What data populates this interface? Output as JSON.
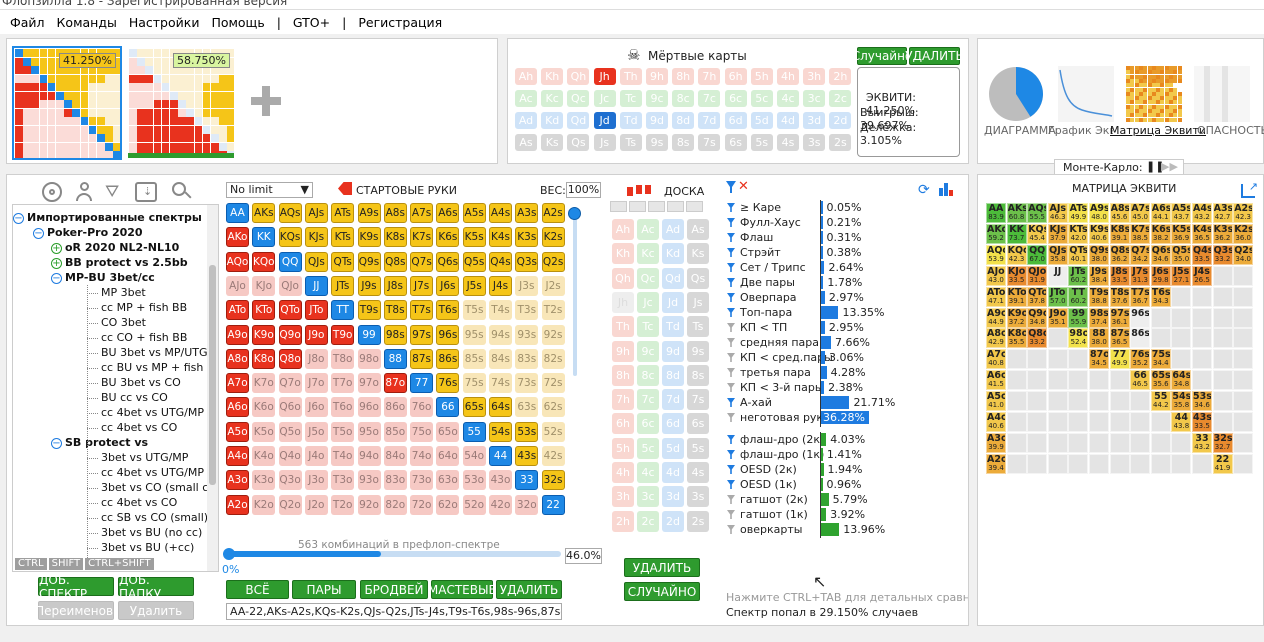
{
  "window_title": "Флопзилла 1.8 - Зарегистрированная версия",
  "menu": [
    "Файл",
    "Команды",
    "Настройки",
    "Помощь",
    "|",
    "GTO+",
    "|",
    "Регистрация"
  ],
  "ranges": [
    {
      "pct": "41.250%"
    },
    {
      "pct": "58.750%"
    }
  ],
  "dead_cards": {
    "title": "Мёртвые карты",
    "random_label": "Случайно",
    "delete_label": "УДАЛИТЬ",
    "rows": [
      {
        "suit": "h",
        "cards": [
          "Ah",
          "Kh",
          "Qh",
          "Jh",
          "Th",
          "9h",
          "8h",
          "7h",
          "6h",
          "5h",
          "4h",
          "3h",
          "2h"
        ]
      },
      {
        "suit": "c",
        "cards": [
          "Ac",
          "Kc",
          "Qc",
          "Jc",
          "Tc",
          "9c",
          "8c",
          "7c",
          "6c",
          "5c",
          "4c",
          "3c",
          "2c"
        ]
      },
      {
        "suit": "d",
        "cards": [
          "Ad",
          "Kd",
          "Qd",
          "Jd",
          "Td",
          "9d",
          "8d",
          "7d",
          "6d",
          "5d",
          "4d",
          "3d",
          "2d"
        ]
      },
      {
        "suit": "s",
        "cards": [
          "As",
          "Ks",
          "Qs",
          "Js",
          "Ts",
          "9s",
          "8s",
          "7s",
          "6s",
          "5s",
          "4s",
          "3s",
          "2s"
        ]
      }
    ],
    "dead": [
      "Jh",
      "Jd"
    ],
    "equity": "ЭКВИТИ: 41.250%",
    "win": "Выигрыш: 39.697%",
    "tie": "Делёжка: 3.105%"
  },
  "views": {
    "tabs": [
      "ДИАГРАММА",
      "График Экв",
      "Матрица Эквити",
      "ОПАСНОСТЬ"
    ],
    "active": "Матрица Эквити",
    "monte_carlo": "Монте-Карло:",
    "pie_fraction": 0.41
  },
  "tree": {
    "items": [
      {
        "label": "Импортированные спектры",
        "level": 1,
        "bold": true,
        "node": "minus"
      },
      {
        "label": "Poker-Pro 2020",
        "level": 2,
        "bold": true,
        "node": "minus"
      },
      {
        "label": "oR 2020 NL2-NL10",
        "level": 3,
        "bold": true,
        "node": "plus"
      },
      {
        "label": "BB protect vs 2.5bb",
        "level": 3,
        "bold": true,
        "node": "plus"
      },
      {
        "label": "MP-BU 3bet/cc",
        "level": 3,
        "bold": true,
        "node": "minus"
      },
      {
        "label": "MP 3bet",
        "level": 4
      },
      {
        "label": "cc MP + fish BB",
        "level": 4
      },
      {
        "label": "CO 3bet",
        "level": 4
      },
      {
        "label": "cc CO + fish BB",
        "level": 4
      },
      {
        "label": "BU 3bet vs MP/UTG",
        "level": 4
      },
      {
        "label": "cc BU vs MP + fish BB",
        "level": 4
      },
      {
        "label": "BU 3bet vs CO",
        "level": 4
      },
      {
        "label": "BU cc vs CO",
        "level": 4
      },
      {
        "label": "cc 4bet vs UTG/MP",
        "level": 4
      },
      {
        "label": "cc 4bet vs CO",
        "level": 4
      },
      {
        "label": "SB protect vs",
        "level": 3,
        "bold": true,
        "node": "minus"
      },
      {
        "label": "3bet vs UTG/MP",
        "level": 4
      },
      {
        "label": "cc 4bet vs UTG/MP",
        "level": 4
      },
      {
        "label": "3bet vs CO (small cc)",
        "level": 4
      },
      {
        "label": "cc 4bet vs CO",
        "level": 4
      },
      {
        "label": "cc SB vs CO (small)",
        "level": 4
      },
      {
        "label": "3bet vs BU (no cc)",
        "level": 4
      },
      {
        "label": "3bet vs BU (+cc)",
        "level": 4
      }
    ],
    "keys": [
      "CTRL",
      "SHIFT",
      "CTRL+SHIFT"
    ],
    "add_range": "ДОБ. СПЕКТР",
    "add_folder": "ДОБ. ПАПКУ",
    "rename": "Переименов.",
    "delete": "Удалить"
  },
  "hands": {
    "mode": "No limit",
    "title": "СТАРТОВЫЕ РУКИ",
    "weight_label": "ВЕС:",
    "weight": "100%",
    "combos": "563 комбинаций в префлоп-спектре",
    "slider_min": "0%",
    "slider_value": "46.0%",
    "slider_fraction": 0.46,
    "buttons": [
      "ВСЁ",
      "ПАРЫ",
      "БРОДВЕЙ",
      "МАСТЕВЫЕ",
      "УДАЛИТЬ"
    ],
    "range_text": "AA-22,AKs-A2s,KQs-K2s,QJs-Q2s,JTs-J4s,T9s-T6s,98s-96s,87s-86s",
    "ranks": [
      "A",
      "K",
      "Q",
      "J",
      "T",
      "9",
      "8",
      "7",
      "6",
      "5",
      "4",
      "3",
      "2"
    ],
    "selected_rows": [
      [
        "A",
        "K",
        "Q",
        "J",
        "T",
        "9",
        "8",
        "7",
        "6",
        "5",
        "4",
        "3",
        "2"
      ],
      [
        "A",
        "K",
        "Q",
        "J",
        "T",
        "9",
        "8",
        "7",
        "6",
        "5",
        "4",
        "3",
        "2"
      ],
      [
        "A",
        "K",
        "Q",
        "J",
        "T",
        "9",
        "8",
        "7",
        "6",
        "5",
        "4",
        "3",
        "2"
      ],
      [
        "J",
        "T",
        "9",
        "8",
        "7",
        "6",
        "5",
        "4"
      ],
      [
        "A",
        "K",
        "Q",
        "J",
        "T",
        "9",
        "8",
        "7",
        "6"
      ],
      [
        "A",
        "K",
        "Q",
        "J",
        "T",
        "9",
        "8",
        "7",
        "6"
      ],
      [
        "A",
        "K",
        "Q",
        "8",
        "7",
        "6"
      ],
      [
        "A",
        "8",
        "7",
        "6"
      ],
      [
        "A",
        "6",
        "5",
        "4"
      ],
      [
        "A",
        "5",
        "4",
        "3"
      ],
      [
        "A",
        "4",
        "3"
      ],
      [
        "A",
        "3",
        "2"
      ],
      [
        "A",
        "2"
      ]
    ]
  },
  "board": {
    "title": "ДОСКА",
    "ranks": [
      "A",
      "K",
      "Q",
      "J",
      "T",
      "9",
      "8",
      "7",
      "6",
      "5",
      "4",
      "3",
      "2"
    ],
    "suits": [
      "h",
      "c",
      "d",
      "s"
    ],
    "dead": [
      "Jh"
    ],
    "delete": "УДАЛИТЬ",
    "random": "СЛУЧАЙНО"
  },
  "stats": {
    "made": [
      {
        "label": "≥ Каре",
        "value": "0.05%",
        "pct": 0.05
      },
      {
        "label": "Фулл-Хаус",
        "value": "0.21%",
        "pct": 0.21
      },
      {
        "label": "Флаш",
        "value": "0.31%",
        "pct": 0.31
      },
      {
        "label": "Стрэйт",
        "value": "0.38%",
        "pct": 0.38
      },
      {
        "label": "Сет / Трипс",
        "value": "2.64%",
        "pct": 2.64
      },
      {
        "label": "Две пары",
        "value": "1.78%",
        "pct": 1.78
      },
      {
        "label": "Оверпара",
        "value": "2.97%",
        "pct": 2.97
      },
      {
        "label": "Топ-пара",
        "value": "13.35%",
        "pct": 13.35
      },
      {
        "label": "КП < ТП",
        "value": "2.95%",
        "pct": 2.95
      },
      {
        "label": "средняя пара",
        "value": "7.66%",
        "pct": 7.66
      },
      {
        "label": "КП < сред.пары",
        "value": "3.06%",
        "pct": 3.06
      },
      {
        "label": "третья пара",
        "value": "4.28%",
        "pct": 4.28
      },
      {
        "label": "КП < 3-й пары",
        "value": "2.38%",
        "pct": 2.38
      },
      {
        "label": "А-хай",
        "value": "21.71%",
        "pct": 21.71
      },
      {
        "label": "неготовая рука",
        "value": "36.28%",
        "pct": 36.28
      }
    ],
    "draws": [
      {
        "label": "флаш-дро (2к)",
        "value": "4.03%",
        "pct": 4.03
      },
      {
        "label": "флаш-дро (1к)",
        "value": "1.41%",
        "pct": 1.41
      },
      {
        "label": "OESD (2к)",
        "value": "1.94%",
        "pct": 1.94
      },
      {
        "label": "OESD (1к)",
        "value": "0.96%",
        "pct": 0.96
      },
      {
        "label": "гатшот (2к)",
        "value": "5.79%",
        "pct": 5.79
      },
      {
        "label": "гатшот (1к)",
        "value": "3.92%",
        "pct": 3.92
      },
      {
        "label": "оверкарты",
        "value": "13.96%",
        "pct": 13.96
      }
    ],
    "hint": "Нажмите CTRL+TAB для детальных сравнений",
    "hit": "Спектр попал в 29.150% случаев"
  },
  "equity_matrix": {
    "title": "МАТРИЦА ЭКВИТИ",
    "cells": [
      [
        [
          "AA",
          "83.9"
        ],
        [
          "AKs",
          "60.8"
        ],
        [
          "AQs",
          "55.5"
        ],
        [
          "AJs",
          "46.3"
        ],
        [
          "ATs",
          "49.9"
        ],
        [
          "A9s",
          "48.0"
        ],
        [
          "A8s",
          "45.6"
        ],
        [
          "A7s",
          "45.0"
        ],
        [
          "A6s",
          "44.1"
        ],
        [
          "A5s",
          "43.7"
        ],
        [
          "A4s",
          "43.2"
        ],
        [
          "A3s",
          "42.7"
        ],
        [
          "A2s",
          "42.3"
        ]
      ],
      [
        [
          "AKo",
          "59.2"
        ],
        [
          "KK",
          "73.7"
        ],
        [
          "KQs",
          "45.4"
        ],
        [
          "KJs",
          "37.9"
        ],
        [
          "KTs",
          "42.0"
        ],
        [
          "K9s",
          "40.6"
        ],
        [
          "K8s",
          "39.1"
        ],
        [
          "K7s",
          "38.5"
        ],
        [
          "K6s",
          "38.2"
        ],
        [
          "K5s",
          "36.9"
        ],
        [
          "K4s",
          "36.5"
        ],
        [
          "K3s",
          "36.2"
        ],
        [
          "K2s",
          "36.0"
        ]
      ],
      [
        [
          "AQo",
          "53.9"
        ],
        [
          "KQo",
          "42.3"
        ],
        [
          "QQ",
          "67.0"
        ],
        [
          "QJs",
          "35.8"
        ],
        [
          "QTs",
          "40.1"
        ],
        [
          "Q9s",
          "38.0"
        ],
        [
          "Q8s",
          "36.2"
        ],
        [
          "Q7s",
          "34.2"
        ],
        [
          "Q6s",
          "34.6"
        ],
        [
          "Q5s",
          "35.0"
        ],
        [
          "Q4s",
          "33.5"
        ],
        [
          "Q3s",
          "33.2"
        ],
        [
          "Q2s",
          "34.0"
        ]
      ],
      [
        [
          "AJo",
          "43.0"
        ],
        [
          "KJo",
          "33.5"
        ],
        [
          "QJo",
          "31.9"
        ],
        [
          "JJ",
          "",
          true
        ],
        [
          "JTs",
          "60.2"
        ],
        [
          "J9s",
          "38.4"
        ],
        [
          "J8s",
          "33.5"
        ],
        [
          "J7s",
          "31.3"
        ],
        [
          "J6s",
          "29.8"
        ],
        [
          "J5s",
          "27.1"
        ],
        [
          "J4s",
          "26.5"
        ],
        [
          "",
          ""
        ],
        [
          "",
          ""
        ]
      ],
      [
        [
          "ATo",
          "47.1"
        ],
        [
          "KTo",
          "39.1"
        ],
        [
          "QTo",
          "37.8"
        ],
        [
          "JTo",
          "57.0"
        ],
        [
          "TT",
          "60.2"
        ],
        [
          "T9s",
          "38.8"
        ],
        [
          "T8s",
          "37.6"
        ],
        [
          "T7s",
          "36.7"
        ],
        [
          "T6s",
          "34.3"
        ],
        [
          "",
          ""
        ],
        [
          "",
          ""
        ],
        [
          "",
          ""
        ],
        [
          "",
          ""
        ]
      ],
      [
        [
          "A9o",
          "44.9"
        ],
        [
          "K9o",
          "37.2"
        ],
        [
          "Q9o",
          "34.8"
        ],
        [
          "J9o",
          "35.1"
        ],
        [
          "99",
          "55.9"
        ],
        [
          "98s",
          "37.4"
        ],
        [
          "97s",
          "36.1"
        ],
        [
          "96s",
          "",
          false
        ],
        [
          "",
          ""
        ],
        [
          "",
          ""
        ],
        [
          "",
          ""
        ],
        [
          "",
          ""
        ],
        [
          "",
          ""
        ]
      ],
      [
        [
          "A8o",
          "42.9"
        ],
        [
          "K8o",
          "35.5"
        ],
        [
          "Q8o",
          "33.2"
        ],
        [
          "",
          ""
        ],
        [
          "98o",
          "52.4"
        ],
        [
          "88",
          "38.0"
        ],
        [
          "87s",
          "36.5"
        ],
        [
          "86s",
          "",
          false
        ],
        [
          "",
          ""
        ],
        [
          "",
          ""
        ],
        [
          "",
          ""
        ],
        [
          "",
          ""
        ],
        [
          "",
          ""
        ]
      ],
      [
        [
          "A7o",
          "40.8"
        ],
        [
          "",
          ""
        ],
        [
          "",
          ""
        ],
        [
          "",
          ""
        ],
        [
          "",
          ""
        ],
        [
          "87o",
          "34.5"
        ],
        [
          "77",
          "49.9"
        ],
        [
          "76s",
          "35.2"
        ],
        [
          "75s",
          "34.4"
        ],
        [
          "",
          ""
        ],
        [
          "",
          ""
        ],
        [
          "",
          ""
        ],
        [
          "",
          ""
        ]
      ],
      [
        [
          "A6o",
          "41.5"
        ],
        [
          "",
          ""
        ],
        [
          "",
          ""
        ],
        [
          "",
          ""
        ],
        [
          "",
          ""
        ],
        [
          "",
          ""
        ],
        [
          "",
          ""
        ],
        [
          "66",
          "46.5"
        ],
        [
          "65s",
          "35.6"
        ],
        [
          "64s",
          "34.8"
        ],
        [
          "",
          ""
        ],
        [
          "",
          ""
        ],
        [
          "",
          ""
        ]
      ],
      [
        [
          "A5o",
          "41.0"
        ],
        [
          "",
          ""
        ],
        [
          "",
          ""
        ],
        [
          "",
          ""
        ],
        [
          "",
          ""
        ],
        [
          "",
          ""
        ],
        [
          "",
          ""
        ],
        [
          "",
          ""
        ],
        [
          "55",
          "44.2"
        ],
        [
          "54s",
          "35.8"
        ],
        [
          "53s",
          "34.6"
        ],
        [
          "",
          ""
        ],
        [
          "",
          ""
        ]
      ],
      [
        [
          "A4o",
          "40.6"
        ],
        [
          "",
          ""
        ],
        [
          "",
          ""
        ],
        [
          "",
          ""
        ],
        [
          "",
          ""
        ],
        [
          "",
          ""
        ],
        [
          "",
          ""
        ],
        [
          "",
          ""
        ],
        [
          "",
          ""
        ],
        [
          "44",
          "43.8"
        ],
        [
          "43s",
          "33.5"
        ],
        [
          "",
          ""
        ],
        [
          "",
          ""
        ]
      ],
      [
        [
          "A3o",
          "39.9"
        ],
        [
          "",
          ""
        ],
        [
          "",
          ""
        ],
        [
          "",
          ""
        ],
        [
          "",
          ""
        ],
        [
          "",
          ""
        ],
        [
          "",
          ""
        ],
        [
          "",
          ""
        ],
        [
          "",
          ""
        ],
        [
          "",
          ""
        ],
        [
          "33",
          "43.2"
        ],
        [
          "32s",
          "32.7"
        ],
        [
          "",
          ""
        ]
      ],
      [
        [
          "A2o",
          "39.4"
        ],
        [
          "",
          ""
        ],
        [
          "",
          ""
        ],
        [
          "",
          ""
        ],
        [
          "",
          ""
        ],
        [
          "",
          ""
        ],
        [
          "",
          ""
        ],
        [
          "",
          ""
        ],
        [
          "",
          ""
        ],
        [
          "",
          ""
        ],
        [
          "",
          ""
        ],
        [
          "22",
          "41.9"
        ],
        [
          "",
          ""
        ]
      ]
    ]
  },
  "colors": {
    "pair": "#1e88e5",
    "offsuit": "#e8321e",
    "suited": "#f5c518",
    "hearts": "#e8897a",
    "clubs": "#7fc97f",
    "diamonds": "#5aa2e6",
    "spades": "#9e9e9e",
    "accent_green": "#2e9b2e",
    "bar_blue": "#1e7be0",
    "bar_green": "#2fa32f"
  }
}
